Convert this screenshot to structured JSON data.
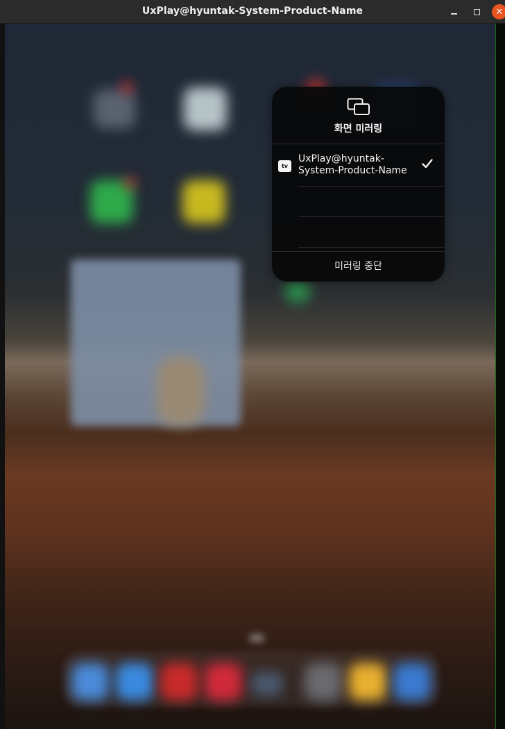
{
  "window": {
    "title": "UxPlay@hyuntak-System-Product-Name",
    "controls": {
      "minimize_icon": "minimize-icon",
      "maximize_icon": "maximize-icon",
      "close_icon": "close-icon",
      "close_glyph": "✕"
    }
  },
  "screen_mirroring": {
    "icon": "screen-mirroring-icon",
    "title": "화면 미러링",
    "devices": [
      {
        "badge_icon": "apple-tv-icon",
        "badge_text": "tv",
        "name": "UxPlay@hyuntak-System-Product-Name",
        "selected": true
      }
    ],
    "stop_label": "미러링 중단"
  },
  "colors": {
    "titlebar": "#2b2b2b",
    "close_button": "#e95420",
    "panel_bg": "#08080a"
  }
}
